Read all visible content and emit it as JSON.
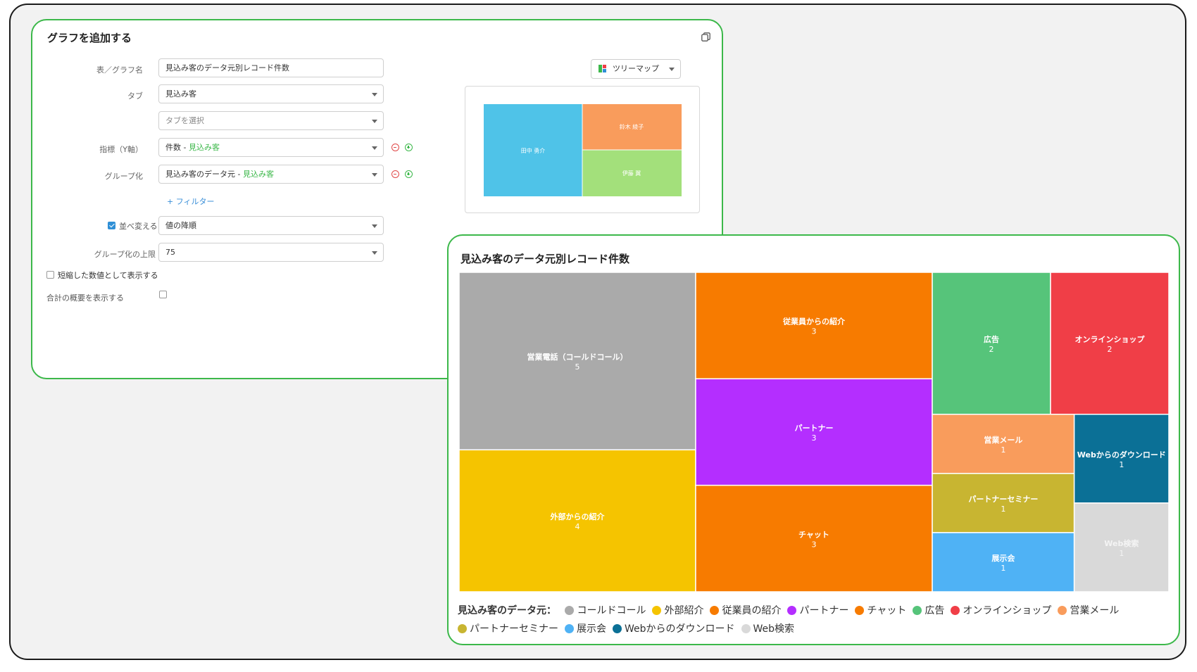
{
  "form": {
    "title": "グラフを追加する",
    "fields": {
      "name_label": "表／グラフ名",
      "name_value": "見込み客のデータ元別レコード件数",
      "tab_label": "タブ",
      "tab_value": "見込み客",
      "tab2_placeholder": "タブを選択",
      "metric_label": "指標（Y軸）",
      "metric_value": "件数 - ",
      "metric_source": "見込み客",
      "group_label": "グループ化",
      "group_value": "見込み客のデータ元 - ",
      "group_source": "見込み客",
      "filter_link": "+ フィルター",
      "sort_label": "並べ変える",
      "sort_value": "値の降順",
      "group_limit_label": "グループ化の上限",
      "group_limit_value": "75",
      "short_number_label": "短縮した数値として表示する",
      "summary_label": "合計の概要を表示する"
    },
    "chart_type": "ツリーマップ",
    "preview": {
      "cells": [
        {
          "label": "田中 勇介",
          "color": "#4fc3e8"
        },
        {
          "label": "鈴木 綾子",
          "color": "#f99c5c"
        },
        {
          "label": "伊藤 翼",
          "color": "#a3e07b"
        }
      ]
    }
  },
  "chart_data": {
    "type": "treemap",
    "title": "見込み客のデータ元別レコード件数",
    "legend_title": "見込み客のデータ元：",
    "items": [
      {
        "name": "営業電話（コールドコール）",
        "legend": "コールドコール",
        "value": 5,
        "color": "#aaaaaa"
      },
      {
        "name": "外部からの紹介",
        "legend": "外部紹介",
        "value": 4,
        "color": "#f5c400"
      },
      {
        "name": "従業員からの紹介",
        "legend": "従業員の紹介",
        "value": 3,
        "color": "#f77b00"
      },
      {
        "name": "パートナー",
        "legend": "パートナー",
        "value": 3,
        "color": "#b42eff"
      },
      {
        "name": "チャット",
        "legend": "チャット",
        "value": 3,
        "color": "#f77b00"
      },
      {
        "name": "広告",
        "legend": "広告",
        "value": 2,
        "color": "#56c47a"
      },
      {
        "name": "オンラインショップ",
        "legend": "オンラインショップ",
        "value": 2,
        "color": "#f03e47"
      },
      {
        "name": "営業メール",
        "legend": "営業メール",
        "value": 1,
        "color": "#f99c5c"
      },
      {
        "name": "パートナーセミナー",
        "legend": "パートナーセミナー",
        "value": 1,
        "color": "#c8b531"
      },
      {
        "name": "展示会",
        "legend": "展示会",
        "value": 1,
        "color": "#4fb2f5"
      },
      {
        "name": "Webからのダウンロード",
        "legend": "Webからのダウンロード",
        "value": 1,
        "color": "#0b7096"
      },
      {
        "name": "Web検索",
        "legend": "Web検索",
        "value": 1,
        "color": "#d9d9d9"
      }
    ]
  }
}
